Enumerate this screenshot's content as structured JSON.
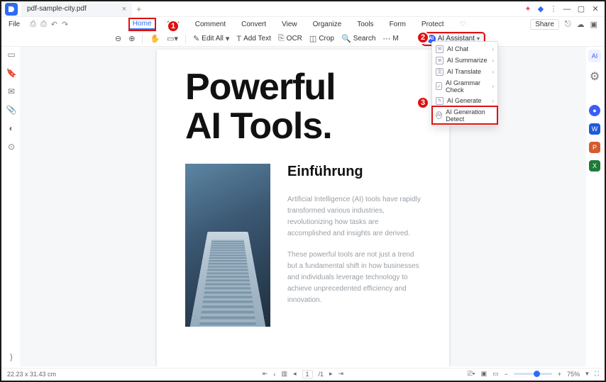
{
  "titlebar": {
    "tab_title": "pdf-sample-city.pdf"
  },
  "menu": {
    "file": "File",
    "tabs": [
      "Home",
      "Edit",
      "Comment",
      "Convert",
      "View",
      "Organize",
      "Tools",
      "Form",
      "Protect"
    ],
    "share": "Share"
  },
  "toolbar": {
    "edit_all": "Edit All",
    "add_text": "Add Text",
    "ocr": "OCR",
    "crop": "Crop",
    "search": "Search",
    "more": "M",
    "ai": "AI Assistant"
  },
  "dropdown": {
    "items": [
      {
        "label": "AI Chat",
        "chev": true
      },
      {
        "label": "AI Summarize",
        "chev": true
      },
      {
        "label": "AI Translate",
        "chev": true
      },
      {
        "label": "AI Grammar Check",
        "chev": true
      },
      {
        "label": "AI Generate",
        "chev": true
      },
      {
        "label": "AI Generation Detect",
        "chev": false
      }
    ]
  },
  "doc": {
    "title_l1": "Powerful",
    "title_l2": "AI Tools.",
    "h2": "Einführung",
    "p1": "Artificial Intelligence (AI) tools have rapidly transformed various industries, revolutionizing how tasks are accomplished and insights are derived.",
    "p2": "These powerful tools are not just a trend but a fundamental shift in how businesses and individuals leverage technology to achieve unprecedented efficiency and innovation."
  },
  "status": {
    "dims": "22.23 x 31.43 cm",
    "page": "1",
    "pages": "/1",
    "zoom": "75%"
  },
  "callouts": {
    "c1": "1",
    "c2": "2",
    "c3": "3"
  }
}
